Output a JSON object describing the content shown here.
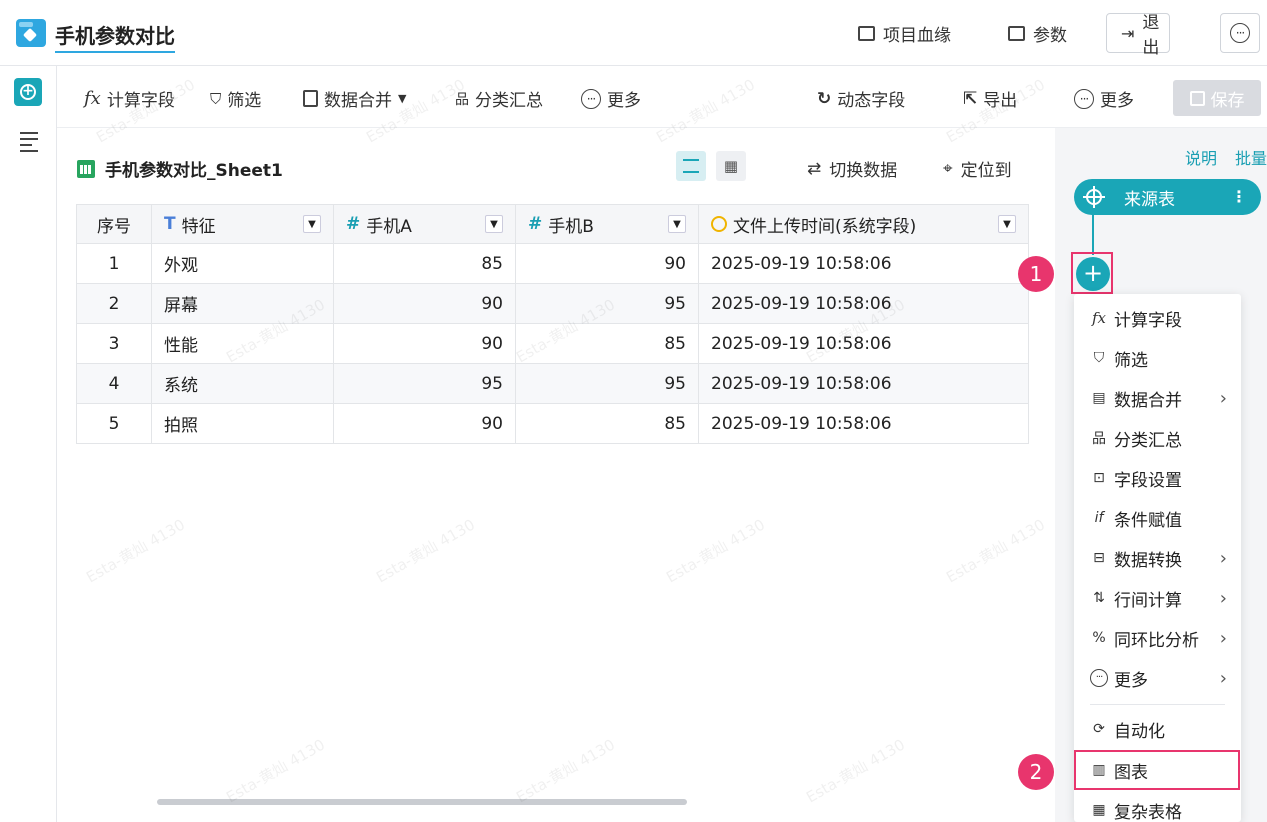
{
  "app": {
    "title": "手机参数对比"
  },
  "header": {
    "lineage": "项目血缘",
    "params": "参数",
    "exit": "退出",
    "more_glyph": "···"
  },
  "toolbar": {
    "fx_glyph": "fx",
    "calc_field": "计算字段",
    "filter": "筛选",
    "merge": "数据合并",
    "merge_caret": "▼",
    "group_summary": "分类汇总",
    "more": "更多",
    "dynamic_field": "动态字段",
    "export": "导出",
    "more_right": "更多",
    "save": "保存"
  },
  "sheet": {
    "title": "手机参数对比_Sheet1",
    "switch_data": "切换数据",
    "locate_to": "定位到",
    "columns": [
      {
        "label": "序号",
        "type": ""
      },
      {
        "label": "特征",
        "type": "text"
      },
      {
        "label": "手机A",
        "type": "number"
      },
      {
        "label": "手机B",
        "type": "number"
      },
      {
        "label": "文件上传时间(系统字段)",
        "type": "datetime"
      }
    ],
    "rows": [
      {
        "idx": "1",
        "feature": "外观",
        "a": "85",
        "b": "90",
        "time": "2025-09-19 10:58:06"
      },
      {
        "idx": "2",
        "feature": "屏幕",
        "a": "90",
        "b": "95",
        "time": "2025-09-19 10:58:06"
      },
      {
        "idx": "3",
        "feature": "性能",
        "a": "90",
        "b": "85",
        "time": "2025-09-19 10:58:06"
      },
      {
        "idx": "4",
        "feature": "系统",
        "a": "95",
        "b": "95",
        "time": "2025-09-19 10:58:06"
      },
      {
        "idx": "5",
        "feature": "拍照",
        "a": "90",
        "b": "85",
        "time": "2025-09-19 10:58:06"
      }
    ]
  },
  "right_panel": {
    "explain": "说明",
    "batch": "批量",
    "source_node": "来源表",
    "add_glyph": "+",
    "badge1": "1",
    "badge2": "2",
    "menu": [
      {
        "label": "计算字段",
        "icon": "fx-icon",
        "submenu": false
      },
      {
        "label": "筛选",
        "icon": "filter-icon",
        "submenu": false
      },
      {
        "label": "数据合并",
        "icon": "merge-icon",
        "submenu": true
      },
      {
        "label": "分类汇总",
        "icon": "tree-icon",
        "submenu": false
      },
      {
        "label": "字段设置",
        "icon": "field-settings-icon",
        "submenu": false
      },
      {
        "label": "条件赋值",
        "icon": "condition-icon",
        "submenu": false
      },
      {
        "label": "数据转换",
        "icon": "transform-icon",
        "submenu": true
      },
      {
        "label": "行间计算",
        "icon": "row-calc-icon",
        "submenu": true
      },
      {
        "label": "同环比分析",
        "icon": "percent-icon",
        "submenu": true
      },
      {
        "label": "更多",
        "icon": "more-icon",
        "submenu": true
      },
      {
        "label": "自动化",
        "icon": "automation-icon",
        "submenu": false
      },
      {
        "label": "图表",
        "icon": "chart-icon",
        "submenu": false
      },
      {
        "label": "复杂表格",
        "icon": "table-icon",
        "submenu": false
      }
    ]
  },
  "watermark": "Esta-黄灿 4130",
  "colors": {
    "accent": "#1aa6b7",
    "highlight": "#e8356d"
  }
}
